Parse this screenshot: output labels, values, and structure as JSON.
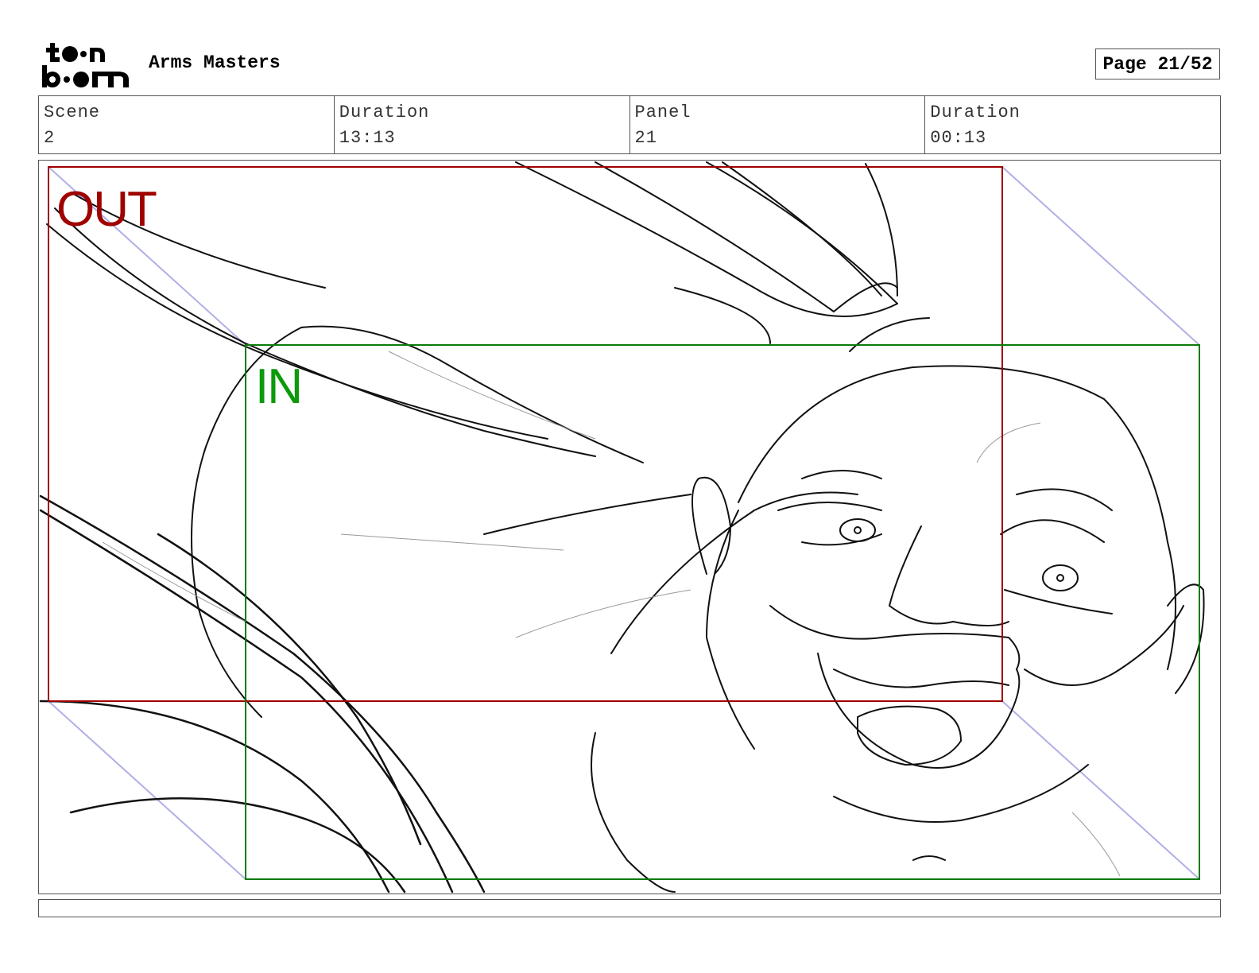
{
  "header": {
    "logo_text": "toon boom",
    "project_title": "Arms Masters",
    "page_label": "Page 21/52"
  },
  "info": [
    {
      "label": "Scene",
      "value": "2"
    },
    {
      "label": "Duration",
      "value": "13:13"
    },
    {
      "label": "Panel",
      "value": "21"
    },
    {
      "label": "Duration",
      "value": "00:13"
    }
  ],
  "panel": {
    "out_label": "OUT",
    "in_label": "IN",
    "out_color": "#a00000",
    "in_color": "#0a7a0a",
    "guide_color": "#b0b0e6"
  },
  "caption": {
    "text": ""
  }
}
